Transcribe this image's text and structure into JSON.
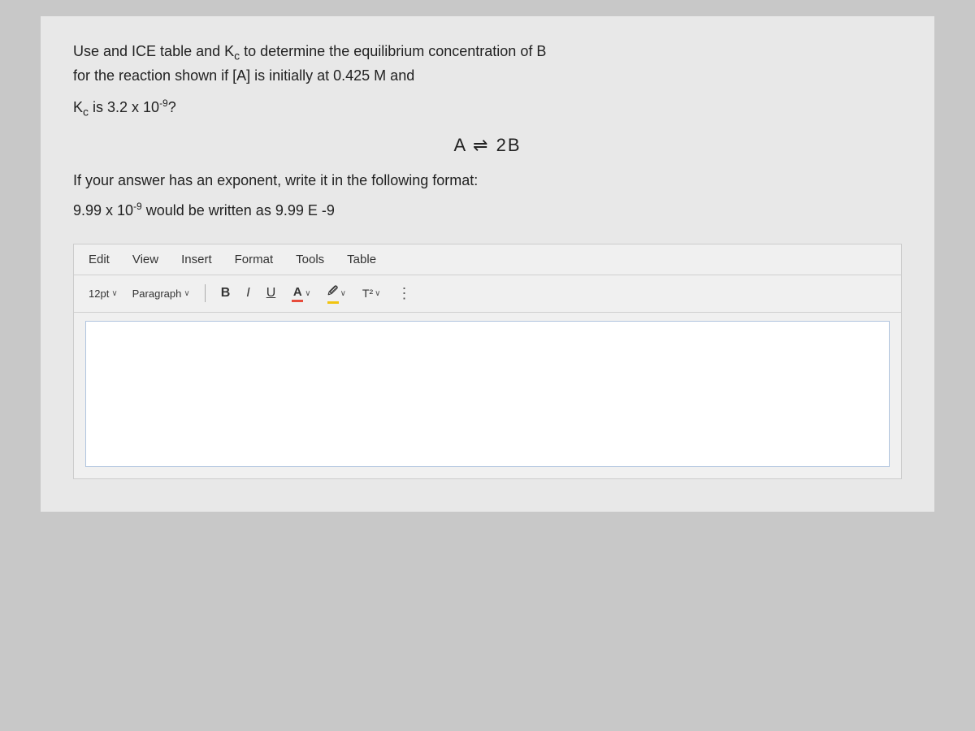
{
  "question": {
    "line1": "Use and ICE table and K",
    "kc_sub": "c",
    "line1_cont": " to determine the equilibrium concentration of B",
    "line2": "for the reaction shown if [A] is initially at 0.425 M and",
    "kc_line_start": "K",
    "kc_line_sub": "c",
    "kc_line_cont": " is 3.2 x 10",
    "kc_exponent": "-9",
    "kc_line_end": "?",
    "reaction": "A ⇌ 2B",
    "format_instruction": "If your answer has an exponent, write it in the following format:",
    "example_start": "9.99 x 10",
    "example_exp": "-9",
    "example_end": " would be written as 9.99 E -9"
  },
  "menu": {
    "items": [
      "Edit",
      "View",
      "Insert",
      "Format",
      "Tools",
      "Table"
    ]
  },
  "toolbar": {
    "font_size": "12pt",
    "font_size_chevron": "∨",
    "paragraph": "Paragraph",
    "paragraph_chevron": "∨",
    "bold": "B",
    "italic": "I",
    "underline": "U",
    "font_color_letter": "A",
    "highlight_letter": "🖉",
    "superscript": "T²",
    "more": "⋮"
  },
  "editor": {
    "placeholder": ""
  }
}
